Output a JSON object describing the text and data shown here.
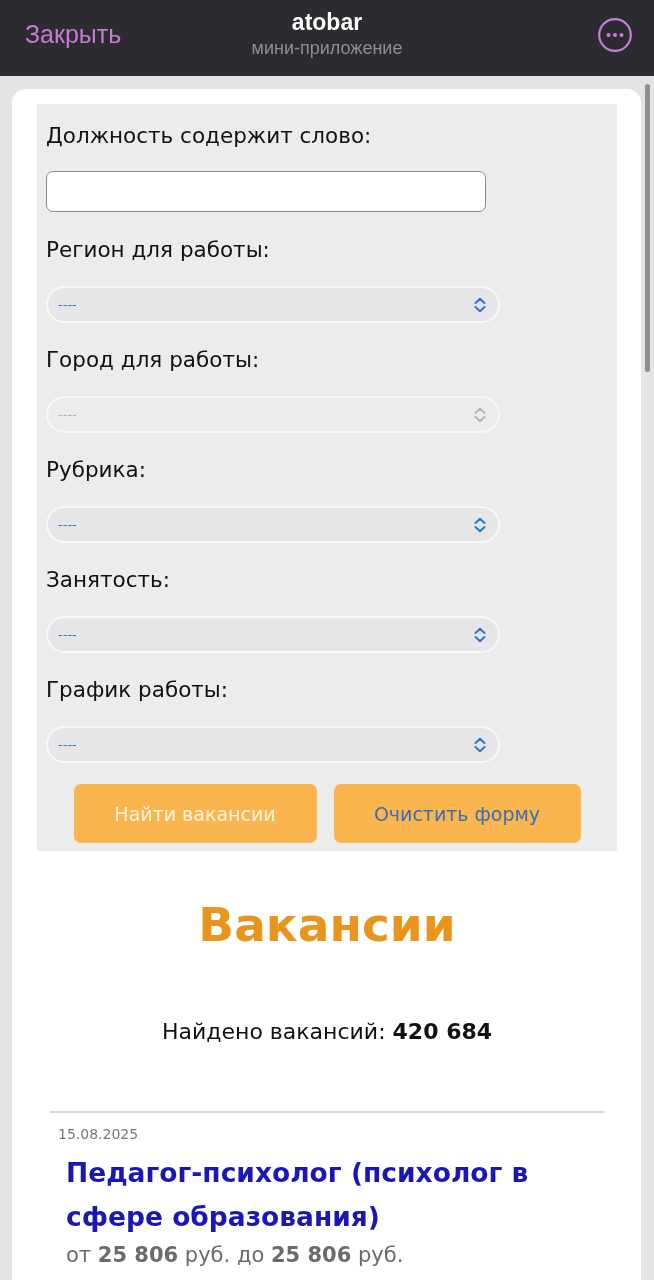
{
  "header": {
    "close": "Закрыть",
    "title": "atobar",
    "subtitle": "мини-приложение"
  },
  "form": {
    "fields": [
      {
        "kind": "text",
        "label": "Должность содержит слово:"
      },
      {
        "kind": "select",
        "label": "Регион для работы:",
        "value": "----",
        "disabled": false
      },
      {
        "kind": "select",
        "label": "Город для работы:",
        "value": "----",
        "disabled": true
      },
      {
        "kind": "select",
        "label": "Рубрика:",
        "value": "----",
        "disabled": false
      },
      {
        "kind": "select",
        "label": "Занятость:",
        "value": "----",
        "disabled": false
      },
      {
        "kind": "select",
        "label": "График работы:",
        "value": "----",
        "disabled": false
      }
    ],
    "buttons": [
      {
        "kind": "submit",
        "label": "Найти вакансии"
      },
      {
        "kind": "reset",
        "label": "Очистить форму"
      }
    ]
  },
  "results": {
    "heading": "Вакансии",
    "count": "Найдено вакансий: **420 684**"
  },
  "vacancies": [
    {
      "date": "15.08.2025",
      "title": "Педагог-психолог (психолог в сфере образования)",
      "salary": "от **25 806** руб. до **25 806** руб."
    }
  ]
}
